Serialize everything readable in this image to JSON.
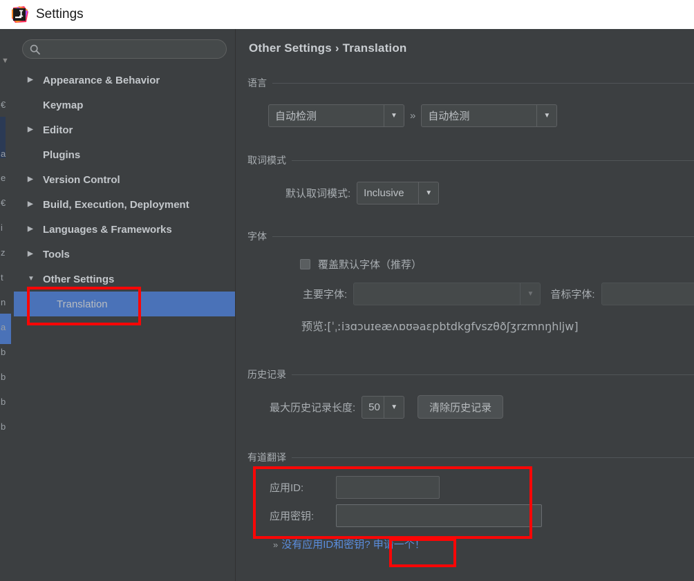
{
  "window": {
    "title": "Settings",
    "app_icon": "intellij-idea-icon"
  },
  "sidebar": {
    "search": {
      "value": "",
      "placeholder": "",
      "icon": "search-icon"
    },
    "items": [
      {
        "label": "Appearance & Behavior",
        "arrow": "collapsed",
        "level": 0,
        "selected": false
      },
      {
        "label": "Keymap",
        "arrow": "none",
        "level": 0,
        "selected": false
      },
      {
        "label": "Editor",
        "arrow": "collapsed",
        "level": 0,
        "selected": false
      },
      {
        "label": "Plugins",
        "arrow": "none",
        "level": 0,
        "selected": false
      },
      {
        "label": "Version Control",
        "arrow": "collapsed",
        "level": 0,
        "selected": false
      },
      {
        "label": "Build, Execution, Deployment",
        "arrow": "collapsed",
        "level": 0,
        "selected": false
      },
      {
        "label": "Languages & Frameworks",
        "arrow": "collapsed",
        "level": 0,
        "selected": false
      },
      {
        "label": "Tools",
        "arrow": "collapsed",
        "level": 0,
        "selected": false
      },
      {
        "label": "Other Settings",
        "arrow": "expanded",
        "level": 0,
        "selected": false
      },
      {
        "label": "Translation",
        "arrow": "none",
        "level": 1,
        "selected": true
      }
    ]
  },
  "content": {
    "breadcrumb": "Other Settings › Translation",
    "language_group": {
      "title": "语言",
      "source": {
        "value": "自动检测"
      },
      "separator": "»",
      "target": {
        "value": "自动检测"
      }
    },
    "word_mode_group": {
      "title": "取词模式",
      "label": "默认取词模式:",
      "value": "Inclusive"
    },
    "font_group": {
      "title": "字体",
      "checkbox_label": "覆盖默认字体（推荐）",
      "checkbox_checked": false,
      "primary_font_label": "主要字体:",
      "primary_font_value": "",
      "phonetic_font_label": "音标字体:",
      "phonetic_font_value": "",
      "preview": "预览:[ˈˌːiɜɑɔuɪeæʌɒʊəaɛpbtdkgfvszθðʃʒrzmnŋhljw]"
    },
    "history_group": {
      "title": "历史记录",
      "label": "最大历史记录长度:",
      "value": "50",
      "clear_button": "清除历史记录"
    },
    "youdao_group": {
      "title": "有道翻译",
      "app_id_label": "应用ID:",
      "app_id_value": "",
      "app_secret_label": "应用密钥:",
      "app_secret_value": "",
      "link_chevron": "»",
      "link_question": "没有应用ID和密钥?",
      "link_action": "申请一个！"
    }
  },
  "annotations": {
    "highlight_color": "#fb0606",
    "boxes": [
      {
        "name": "translation-tree-item-highlight"
      },
      {
        "name": "youdao-credentials-highlight"
      },
      {
        "name": "apply-link-highlight"
      }
    ]
  },
  "background_window": {
    "fragments": [
      "a",
      "e",
      "€",
      "i",
      "z",
      "t",
      "n",
      "a",
      "b",
      "b",
      "b",
      "b"
    ]
  }
}
